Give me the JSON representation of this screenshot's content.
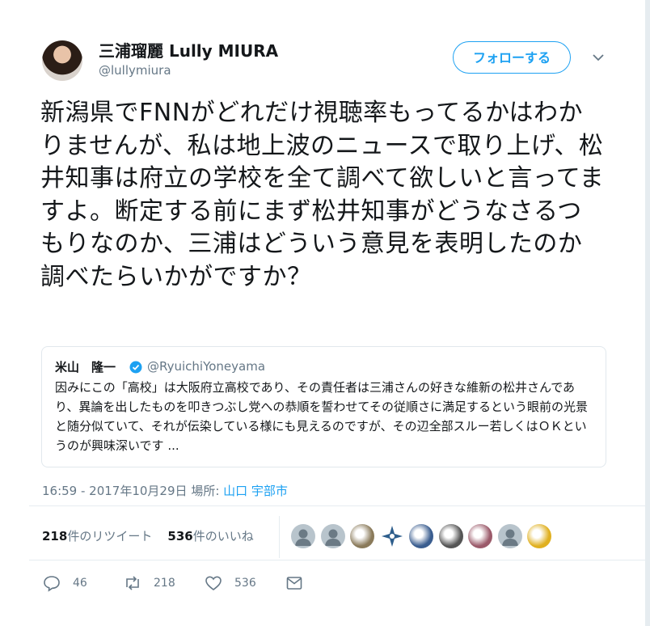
{
  "author": {
    "name": "三浦瑠麗 Lully MIURA",
    "handle": "@lullymiura"
  },
  "follow_button": "フォローする",
  "tweet": {
    "text": "新潟県でFNNがどれだけ視聴率もってるかはわかりませんが、私は地上波のニュースで取り上げ、松井知事は府立の学校を全て調べて欲しいと言ってますよ。断定する前にまず松井知事がどうなさるつもりなのか、三浦はどういう意見を表明したのか調べたらいかがですか？"
  },
  "quoted_tweet": {
    "name": "米山　隆一",
    "handle": "@RyuichiYoneyama",
    "text": "因みにこの「高校」は大阪府立高校であり、その責任者は三浦さんの好きな維新の松井さんであり、異論を出したものを叩きつぶし党への恭順を誓わせてその従順さに満足するという眼前の光景と随分似ていて、それが伝染している様にも見えるのですが、その辺全部スルー若しくはＯＫというのが興味深いです ..."
  },
  "meta": {
    "timestamp": "16:59 - 2017年10月29日",
    "location_label": "場所:",
    "location": "山口 宇部市"
  },
  "stats": {
    "retweets_count": "218",
    "retweets_label": "件のリツイート",
    "likes_count": "536",
    "likes_label": "件のいいね"
  },
  "likers": [
    {
      "icon": "default-avatar-icon",
      "color": "#b8c4cc"
    },
    {
      "icon": "default-avatar-icon",
      "color": "#b8c4cc"
    },
    {
      "icon": "photo-avatar-icon",
      "color": "#8a7a5a"
    },
    {
      "icon": "compass-avatar-icon",
      "color": "#2e5e8c"
    },
    {
      "icon": "photo-avatar-icon",
      "color": "#3a5d8f"
    },
    {
      "icon": "photo-avatar-icon",
      "color": "#555555"
    },
    {
      "icon": "photo-avatar-icon",
      "color": "#9b5a6a"
    },
    {
      "icon": "default-avatar-icon",
      "color": "#b8c4cc"
    },
    {
      "icon": "photo-avatar-icon",
      "color": "#e0b020"
    }
  ],
  "actions": {
    "reply_count": "46",
    "retweet_count": "218",
    "like_count": "536"
  },
  "colors": {
    "accent": "#1da1f2",
    "secondary_text": "#657786"
  }
}
